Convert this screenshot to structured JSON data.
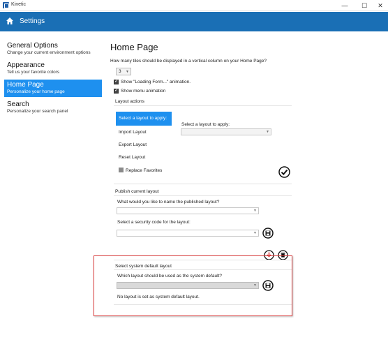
{
  "window": {
    "app_title": "Kinetic",
    "minimize_glyph": "—",
    "maximize_glyph": "☐",
    "close_glyph": "✕"
  },
  "header": {
    "title": "Settings",
    "icon": "home-icon"
  },
  "sidebar": {
    "items": [
      {
        "title": "General Options",
        "desc": "Change your current environment options"
      },
      {
        "title": "Appearance",
        "desc": "Tell us your favorite colors"
      },
      {
        "title": "Home Page",
        "desc": "Personalize your home page",
        "active": true
      },
      {
        "title": "Search",
        "desc": "Personalize your search panel"
      }
    ]
  },
  "main": {
    "title": "Home Page",
    "tiles_question": "How many tiles should be displayed in a vertical column on your Home Page?",
    "tiles_value": "3",
    "show_loading_form": "Show \"Loading Form...\" animation.",
    "show_menu_animation": "Show menu animation",
    "layout_actions": {
      "label": "Layout actions",
      "apply_button": "Select a layout to apply:",
      "select_label": "Select a layout to apply:",
      "import": "Import Layout",
      "export": "Export Layout",
      "reset": "Reset Layout",
      "replace_favorites": "Replace Favorites"
    },
    "publish": {
      "label": "Publish current layout",
      "name_question": "What would you like to name the published layout?",
      "security_question": "Select a security code for the layout:"
    },
    "system_default": {
      "label": "Select system default layout",
      "question": "Which layout should be used as the system default?",
      "status": "No layout is set as system default layout."
    }
  },
  "colors": {
    "header": "#1a6fb5",
    "accent": "#1e90ef",
    "highlight_box": "#d93b3b"
  }
}
